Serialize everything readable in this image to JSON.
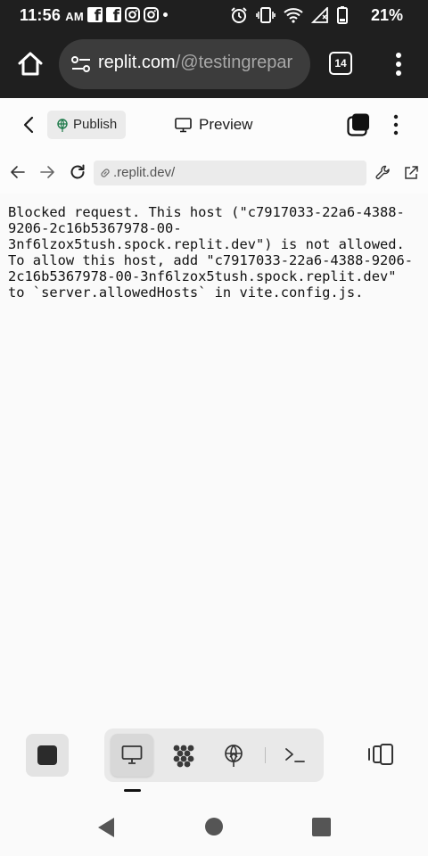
{
  "status_bar": {
    "time": "11:56",
    "ampm": "AM",
    "battery_percent": "21%"
  },
  "browser": {
    "url_domain": "replit.com",
    "url_path": "/@testingrepar",
    "tab_count": "14"
  },
  "app_bar": {
    "publish_label": "Publish",
    "title": "Preview"
  },
  "webview": {
    "address": ".replit.dev/"
  },
  "content": {
    "lines": [
      "Blocked request. This host (\"c7917033-22a6-4388-",
      "9206-2c16b5367978-00-",
      "3nf6lzox5tush.spock.replit.dev\") is not allowed.",
      "To allow this host, add \"c7917033-22a6-4388-9206-",
      "2c16b5367978-00-3nf6lzox5tush.spock.replit.dev\"",
      "to `server.allowedHosts` in vite.config.js."
    ]
  },
  "icons": {
    "status_left": [
      "facebook-icon",
      "facebook-icon",
      "instagram-icon",
      "instagram-icon",
      "dot-icon"
    ],
    "status_right": [
      "alarm-icon",
      "vibrate-icon",
      "wifi-icon",
      "signal-icon",
      "battery-icon"
    ],
    "dock": [
      "monitor-icon",
      "workspace-icon",
      "globe-deploy-icon",
      "terminal-icon"
    ]
  },
  "colors": {
    "system_bar": "#1f1f1f",
    "url_pill": "#3c3c3c",
    "page_bg": "#fafafa",
    "publish_globe": "#1e7a4a"
  }
}
